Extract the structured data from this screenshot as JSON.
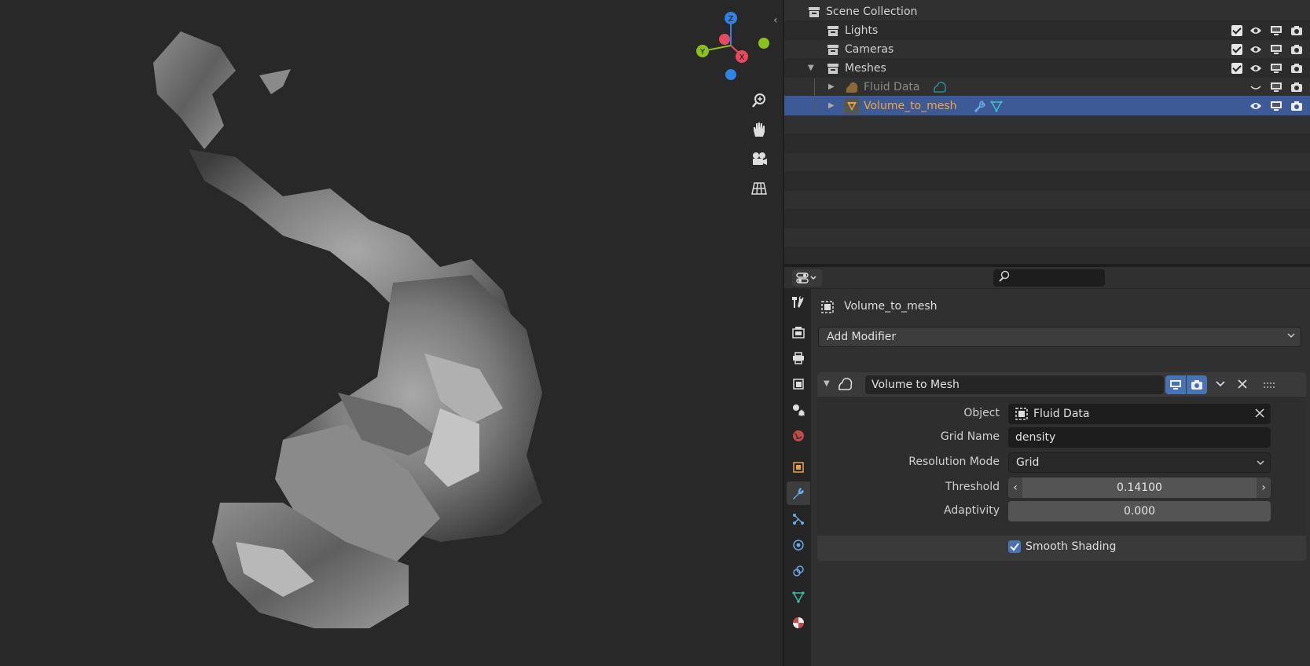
{
  "outliner": {
    "scene_collection": "Scene Collection",
    "rows": [
      {
        "label": "Lights"
      },
      {
        "label": "Cameras"
      },
      {
        "label": "Meshes"
      },
      {
        "label": "Fluid Data"
      },
      {
        "label": "Volume_to_mesh"
      }
    ]
  },
  "properties": {
    "object_name": "Volume_to_mesh",
    "add_modifier": "Add Modifier",
    "modifier": {
      "name": "Volume to Mesh",
      "object_label": "Object",
      "object_value": "Fluid Data",
      "grid_name_label": "Grid Name",
      "grid_name_value": "density",
      "resolution_mode_label": "Resolution Mode",
      "resolution_mode_value": "Grid",
      "threshold_label": "Threshold",
      "threshold_value": "0.14100",
      "adaptivity_label": "Adaptivity",
      "adaptivity_value": "0.000",
      "smooth_shading_label": "Smooth Shading",
      "smooth_shading_checked": true
    }
  },
  "gizmo": {
    "x": "X",
    "y": "Y",
    "z": "Z"
  },
  "colors": {
    "selection": "#3d5a96",
    "accent_blue": "#4772b3",
    "object_orange": "#e8a33b",
    "axis_x": "#e84a5f",
    "axis_y": "#8bc01f",
    "axis_z": "#2f83e3"
  },
  "icons": [
    "zoom-icon",
    "hand-pan-icon",
    "camera-icon",
    "grid-icon",
    "collection-icon",
    "checkbox-icon",
    "eye-icon",
    "monitor-icon",
    "camera-render-icon",
    "wrench-icon",
    "mesh-data-icon",
    "volume-icon",
    "search-icon",
    "close-icon",
    "drag-handle-icon"
  ]
}
